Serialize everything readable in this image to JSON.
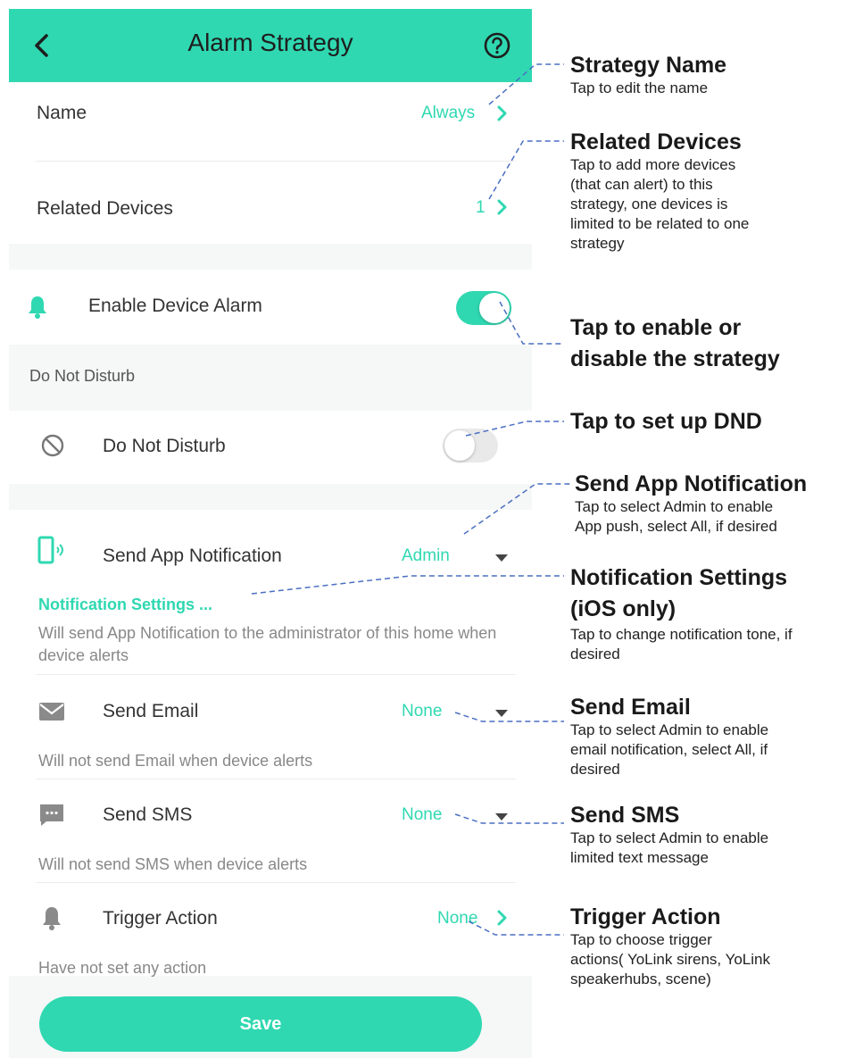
{
  "header": {
    "title": "Alarm Strategy"
  },
  "name_row": {
    "label": "Name",
    "value": "Always"
  },
  "devices_row": {
    "label": "Related Devices",
    "value": "1"
  },
  "enable_row": {
    "label": "Enable Device Alarm",
    "enabled": true
  },
  "dnd_section": {
    "heading": "Do Not Disturb"
  },
  "dnd_row": {
    "label": "Do Not Disturb",
    "enabled": false
  },
  "app_row": {
    "label": "Send App Notification",
    "value": "Admin",
    "settings_link": "Notification Settings ...",
    "description": "Will send App Notification to the administrator of this home when device alerts"
  },
  "email_row": {
    "label": "Send Email",
    "value": "None",
    "description": "Will not send Email when device alerts"
  },
  "sms_row": {
    "label": "Send SMS",
    "value": "None",
    "description": "Will not send SMS when device alerts"
  },
  "trigger_row": {
    "label": "Trigger Action",
    "value": "None",
    "description": "Have not set any action"
  },
  "save_label": "Save",
  "annotations": {
    "strategy_name": {
      "title": "Strategy Name",
      "desc": "Tap to edit the name"
    },
    "related_devices": {
      "title": "Related Devices",
      "desc": [
        "Tap to add more devices",
        "(that can alert) to this",
        "strategy, one devices is",
        "limited to be related to one",
        "strategy"
      ]
    },
    "enable": {
      "title": [
        "Tap to enable or",
        "disable the strategy"
      ]
    },
    "dnd": {
      "title": "Tap to set up DND"
    },
    "app_notification": {
      "title": "Send App Notification",
      "desc": [
        "Tap to select Admin to enable",
        "App push, select All, if desired"
      ]
    },
    "notification_settings": {
      "title": [
        "Notification Settings",
        "(iOS only)"
      ],
      "desc": [
        "Tap to change notification tone, if",
        "desired"
      ]
    },
    "email": {
      "title": "Send Email",
      "desc": [
        "Tap to select Admin to enable",
        "email notification, select All, if",
        "desired"
      ]
    },
    "sms": {
      "title": "Send SMS",
      "desc": [
        "Tap to select Admin to enable",
        "limited text message"
      ]
    },
    "trigger": {
      "title": "Trigger Action",
      "desc": [
        "Tap to choose trigger",
        "actions( YoLink sirens, YoLink",
        "speakerhubs, scene)"
      ]
    }
  },
  "colors": {
    "accent": "#2fd8b1",
    "background": "#f6f7f7",
    "leader": "#4a6fc2"
  },
  "icons": [
    "back-arrow-icon",
    "help-icon",
    "bell-icon",
    "no-entry-icon",
    "phone-notification-icon",
    "mail-icon",
    "sms-icon",
    "bell-icon",
    "chevron-right-icon",
    "caret-down-icon"
  ]
}
